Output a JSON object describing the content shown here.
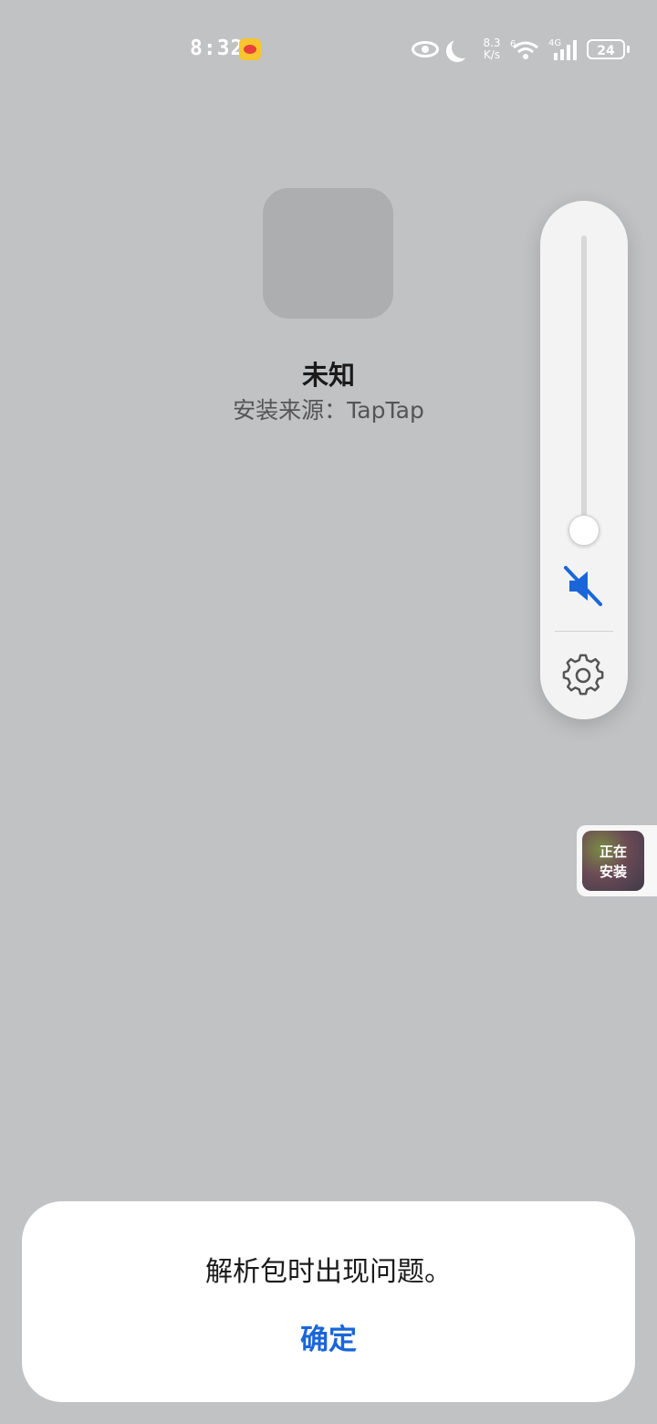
{
  "status_bar": {
    "time": "8:32",
    "net_speed_value": "8.3",
    "net_speed_unit": "K/s",
    "wifi_badge": "6",
    "network_type": "4G",
    "battery": "24"
  },
  "app": {
    "name": "未知",
    "install_source": "安装来源：TapTap"
  },
  "volume_panel": {
    "level": 0.0,
    "muted": true,
    "accent_color": "#1a66d8"
  },
  "install_float": {
    "label_line1": "正在",
    "label_line2": "安装"
  },
  "dialog": {
    "message": "解析包时出现问题。",
    "confirm_label": "确定"
  }
}
